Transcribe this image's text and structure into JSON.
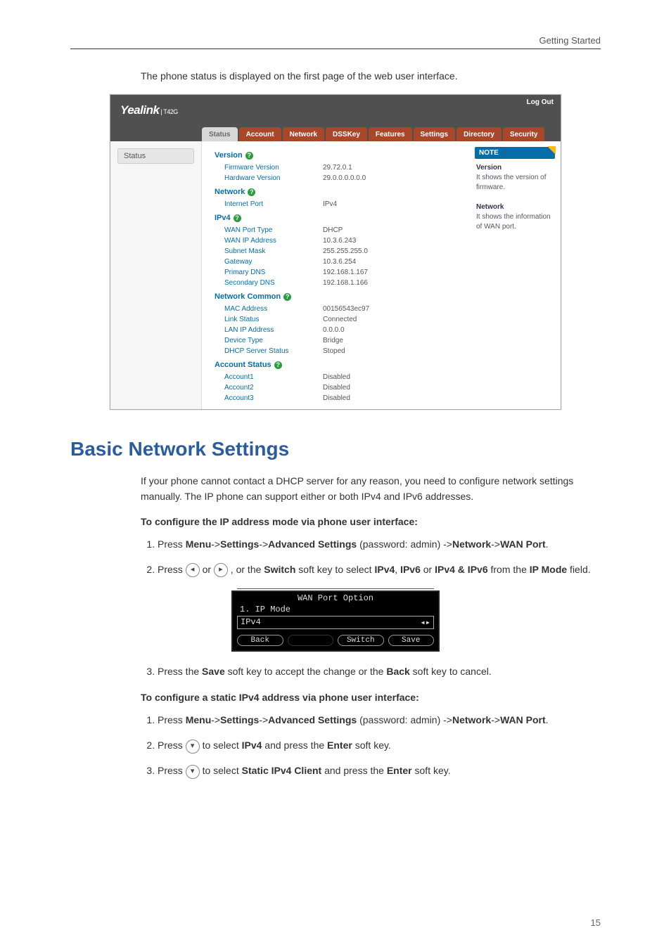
{
  "header": {
    "section": "Getting Started"
  },
  "intro": "The phone status is displayed on the first page of the web user interface.",
  "webui": {
    "brand": "Yealink",
    "model": "T42G",
    "logout": "Log Out",
    "tabs": [
      "Status",
      "Account",
      "Network",
      "DSSKey",
      "Features",
      "Settings",
      "Directory",
      "Security"
    ],
    "active_tab": "Status",
    "side_item": "Status",
    "note": {
      "head": "NOTE",
      "version_label": "Version",
      "version_text": "It shows the version of firmware.",
      "network_label": "Network",
      "network_text": "It shows the information of WAN port."
    },
    "sections": {
      "version": {
        "head": "Version",
        "rows": [
          {
            "label": "Firmware Version",
            "value": "29.72.0.1"
          },
          {
            "label": "Hardware Version",
            "value": "29.0.0.0.0.0.0"
          }
        ]
      },
      "network": {
        "head": "Network",
        "rows": [
          {
            "label": "Internet Port",
            "value": "IPv4"
          }
        ]
      },
      "ipv4": {
        "head": "IPv4",
        "rows": [
          {
            "label": "WAN Port Type",
            "value": "DHCP"
          },
          {
            "label": "WAN IP Address",
            "value": "10.3.6.243"
          },
          {
            "label": "Subnet Mask",
            "value": "255.255.255.0"
          },
          {
            "label": "Gateway",
            "value": "10.3.6.254"
          },
          {
            "label": "Primary DNS",
            "value": "192.168.1.167"
          },
          {
            "label": "Secondary DNS",
            "value": "192.168.1.166"
          }
        ]
      },
      "common": {
        "head": "Network Common",
        "rows": [
          {
            "label": "MAC Address",
            "value": "00156543ec97"
          },
          {
            "label": "Link Status",
            "value": "Connected"
          },
          {
            "label": "LAN IP Address",
            "value": "0.0.0.0"
          },
          {
            "label": "Device Type",
            "value": "Bridge"
          },
          {
            "label": "DHCP Server Status",
            "value": "Stoped"
          }
        ]
      },
      "accounts": {
        "head": "Account Status",
        "rows": [
          {
            "label": "Account1",
            "value": "Disabled"
          },
          {
            "label": "Account2",
            "value": "Disabled"
          },
          {
            "label": "Account3",
            "value": "Disabled"
          }
        ]
      }
    }
  },
  "h1": "Basic Network Settings",
  "para1": "If your phone cannot contact a DHCP server for any reason, you need to configure network settings manually. The IP phone can support either or both IPv4 and IPv6 addresses.",
  "procA": {
    "title": "To configure the IP address mode via phone user interface:",
    "s1": {
      "pre": "Press ",
      "m1": "Menu",
      "sep1": "->",
      "m2": "Settings",
      "sep2": "->",
      "m3": "Advanced Settings",
      "mid": " (password: admin) ->",
      "m4": "Network",
      "sep4": "->",
      "m5": "WAN Port",
      "end": "."
    },
    "s2": {
      "pre": "Press ",
      "or": " or ",
      "mid1": " , or the ",
      "b1": "Switch",
      "mid2": " soft key to select ",
      "b2": "IPv4",
      "c1": ", ",
      "b3": "IPv6",
      "mid3": " or ",
      "b4": "IPv4 & IPv6",
      "mid4": " from the ",
      "b5": "IP Mode",
      "end": " field."
    },
    "s3": {
      "pre": "Press the ",
      "b1": "Save",
      "mid": " soft key to accept the change or the ",
      "b2": "Back",
      "end": " soft key to cancel."
    }
  },
  "lcd": {
    "title": "WAN Port Option",
    "row1": "1. IP Mode",
    "value": "IPv4",
    "arrows": "◂▸",
    "sk": [
      "Back",
      "",
      "Switch",
      "Save"
    ]
  },
  "procB": {
    "title": "To configure a static IPv4 address via phone user interface:",
    "s1": {
      "pre": "Press ",
      "m1": "Menu",
      "sep1": "->",
      "m2": "Settings",
      "sep2": "->",
      "m3": "Advanced Settings",
      "mid": " (password: admin) ->",
      "m4": "Network",
      "sep4": "->",
      "m5": "WAN Port",
      "end": "."
    },
    "s2": {
      "pre": "Press ",
      "mid1": " to select ",
      "b1": "IPv4",
      "mid2": " and press the ",
      "b2": "Enter",
      "end": " soft key."
    },
    "s3": {
      "pre": "Press ",
      "mid1": " to select ",
      "b1": "Static IPv4 Client",
      "mid2": " and press the ",
      "b2": "Enter",
      "end": " soft key."
    }
  },
  "page_number": "15"
}
